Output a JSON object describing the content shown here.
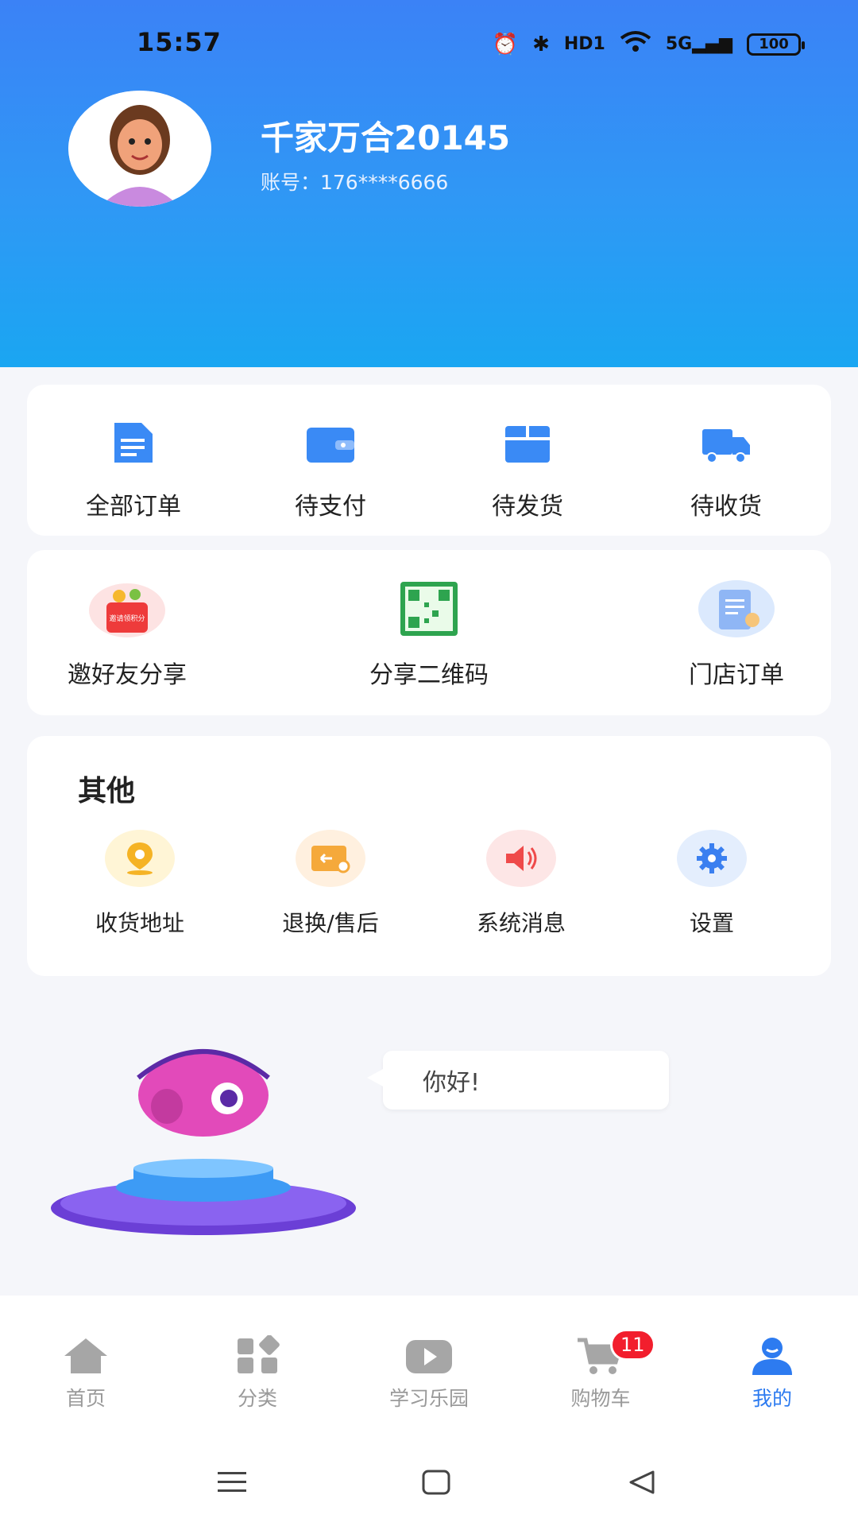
{
  "status": {
    "time": "15:57",
    "network": "5G",
    "hd": "HD1",
    "battery": "100"
  },
  "profile": {
    "username": "千家万合20145",
    "account": "账号：176****6666"
  },
  "orders": [
    {
      "label": "全部订单",
      "icon": "document-icon"
    },
    {
      "label": "待支付",
      "icon": "wallet-icon"
    },
    {
      "label": "待发货",
      "icon": "box-icon"
    },
    {
      "label": "待收货",
      "icon": "truck-icon"
    }
  ],
  "shares": [
    {
      "label": "邀好友分享",
      "icon": "invite-gift-icon",
      "caption": "邀请领积分"
    },
    {
      "label": "分享二维码",
      "icon": "qr-code-icon"
    },
    {
      "label": "门店订单",
      "icon": "store-order-icon"
    }
  ],
  "other": {
    "title": "其他",
    "items": [
      {
        "label": "收货地址",
        "icon": "location-icon"
      },
      {
        "label": "退换/售后",
        "icon": "return-icon"
      },
      {
        "label": "系统消息",
        "icon": "speaker-icon"
      },
      {
        "label": "设置",
        "icon": "gear-icon"
      }
    ]
  },
  "assistant": {
    "greeting": "你好!"
  },
  "nav": {
    "items": [
      {
        "label": "首页",
        "icon": "home-icon"
      },
      {
        "label": "分类",
        "icon": "category-icon"
      },
      {
        "label": "学习乐园",
        "icon": "play-icon"
      },
      {
        "label": "购物车",
        "icon": "cart-icon",
        "badge": "11"
      },
      {
        "label": "我的",
        "icon": "user-icon",
        "active": true
      }
    ]
  },
  "colors": {
    "accent": "#2d7bf0",
    "header_top": "#3b82f6",
    "header_bottom": "#1aa6f2",
    "badge": "#f21e2d"
  }
}
